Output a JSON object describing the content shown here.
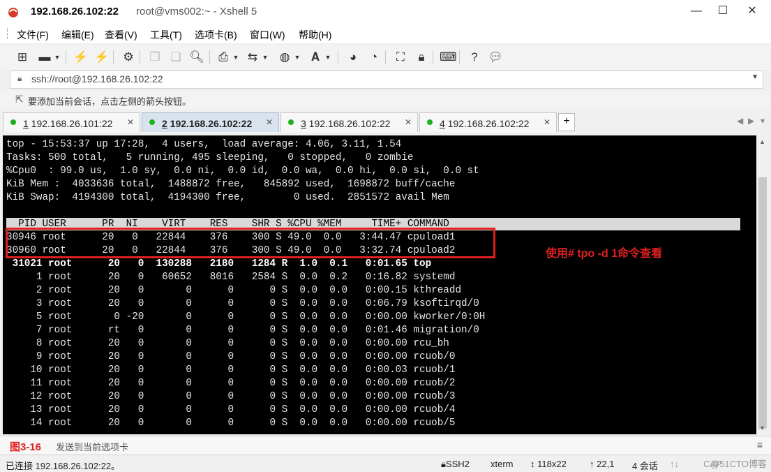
{
  "window": {
    "title_main": "192.168.26.102:22",
    "title_sub": "root@vms002:~ - Xshell 5"
  },
  "menu": [
    "文件(F)",
    "编辑(E)",
    "查看(V)",
    "工具(T)",
    "选项卡(B)",
    "窗口(W)",
    "帮助(H)"
  ],
  "address": "ssh://root@192.168.26.102:22",
  "hint": "要添加当前会话，点击左侧的箭头按钮。",
  "tabs": [
    {
      "num": "1",
      "host": " 192.168.26.101:22",
      "active": false
    },
    {
      "num": "2",
      "host": " 192.168.26.102:22",
      "active": true
    },
    {
      "num": "3",
      "host": " 192.168.26.102:22",
      "active": false
    },
    {
      "num": "4",
      "host": " 192.168.26.102:22",
      "active": false
    }
  ],
  "terminal": {
    "summary": [
      "top - 15:53:37 up 17:28,  4 users,  load average: 4.06, 3.11, 1.54",
      "Tasks: 500 total,   5 running, 495 sleeping,   0 stopped,   0 zombie",
      "%Cpu0  : 99.0 us,  1.0 sy,  0.0 ni,  0.0 id,  0.0 wa,  0.0 hi,  0.0 si,  0.0 st",
      "KiB Mem :  4033636 total,  1488872 free,   845892 used,  1698872 buff/cache",
      "KiB Swap:  4194300 total,  4194300 free,        0 used.  2851572 avail Mem"
    ],
    "header": "  PID USER      PR  NI    VIRT    RES    SHR S %CPU %MEM     TIME+ COMMAND",
    "processes": [
      {
        "line": "30946 root      20   0   22844    376    300 S 49.0  0.0   3:44.47 cpuload1",
        "bold": false
      },
      {
        "line": "30960 root      20   0   22844    376    300 S 49.0  0.0   3:32.74 cpuload2",
        "bold": false
      },
      {
        "line": " 31021 root      20   0  130288   2180   1284 R  1.0  0.1   0:01.65 top",
        "bold": true
      },
      {
        "line": "     1 root      20   0   60652   8016   2584 S  0.0  0.2   0:16.82 systemd",
        "bold": false
      },
      {
        "line": "     2 root      20   0       0      0      0 S  0.0  0.0   0:00.15 kthreadd",
        "bold": false
      },
      {
        "line": "     3 root      20   0       0      0      0 S  0.0  0.0   0:06.79 ksoftirqd/0",
        "bold": false
      },
      {
        "line": "     5 root       0 -20       0      0      0 S  0.0  0.0   0:00.00 kworker/0:0H",
        "bold": false
      },
      {
        "line": "     7 root      rt   0       0      0      0 S  0.0  0.0   0:01.46 migration/0",
        "bold": false
      },
      {
        "line": "     8 root      20   0       0      0      0 S  0.0  0.0   0:00.00 rcu_bh",
        "bold": false
      },
      {
        "line": "     9 root      20   0       0      0      0 S  0.0  0.0   0:00.00 rcuob/0",
        "bold": false
      },
      {
        "line": "    10 root      20   0       0      0      0 S  0.0  0.0   0:00.03 rcuob/1",
        "bold": false
      },
      {
        "line": "    11 root      20   0       0      0      0 S  0.0  0.0   0:00.00 rcuob/2",
        "bold": false
      },
      {
        "line": "    12 root      20   0       0      0      0 S  0.0  0.0   0:00.00 rcuob/3",
        "bold": false
      },
      {
        "line": "    13 root      20   0       0      0      0 S  0.0  0.0   0:00.00 rcuob/4",
        "bold": false
      },
      {
        "line": "    14 root      20   0       0      0      0 S  0.0  0.0   0:00.00 rcuob/5",
        "bold": false
      }
    ]
  },
  "annotation": "使用# tpo -d 1命令查看",
  "figure_label": "图3-16",
  "send_text": "发送到当前选项卡",
  "status": {
    "connected": "已连接 192.168.26.102:22。",
    "protocol": "SSH2",
    "term": "xterm",
    "size": "118x22",
    "cursor": "22,1",
    "sessions": "4 会话",
    "cap": "CAP",
    "watermark": "@51CTO博客"
  },
  "colors": {
    "accent_red": "#e02020",
    "status_green": "#1bb21b"
  }
}
